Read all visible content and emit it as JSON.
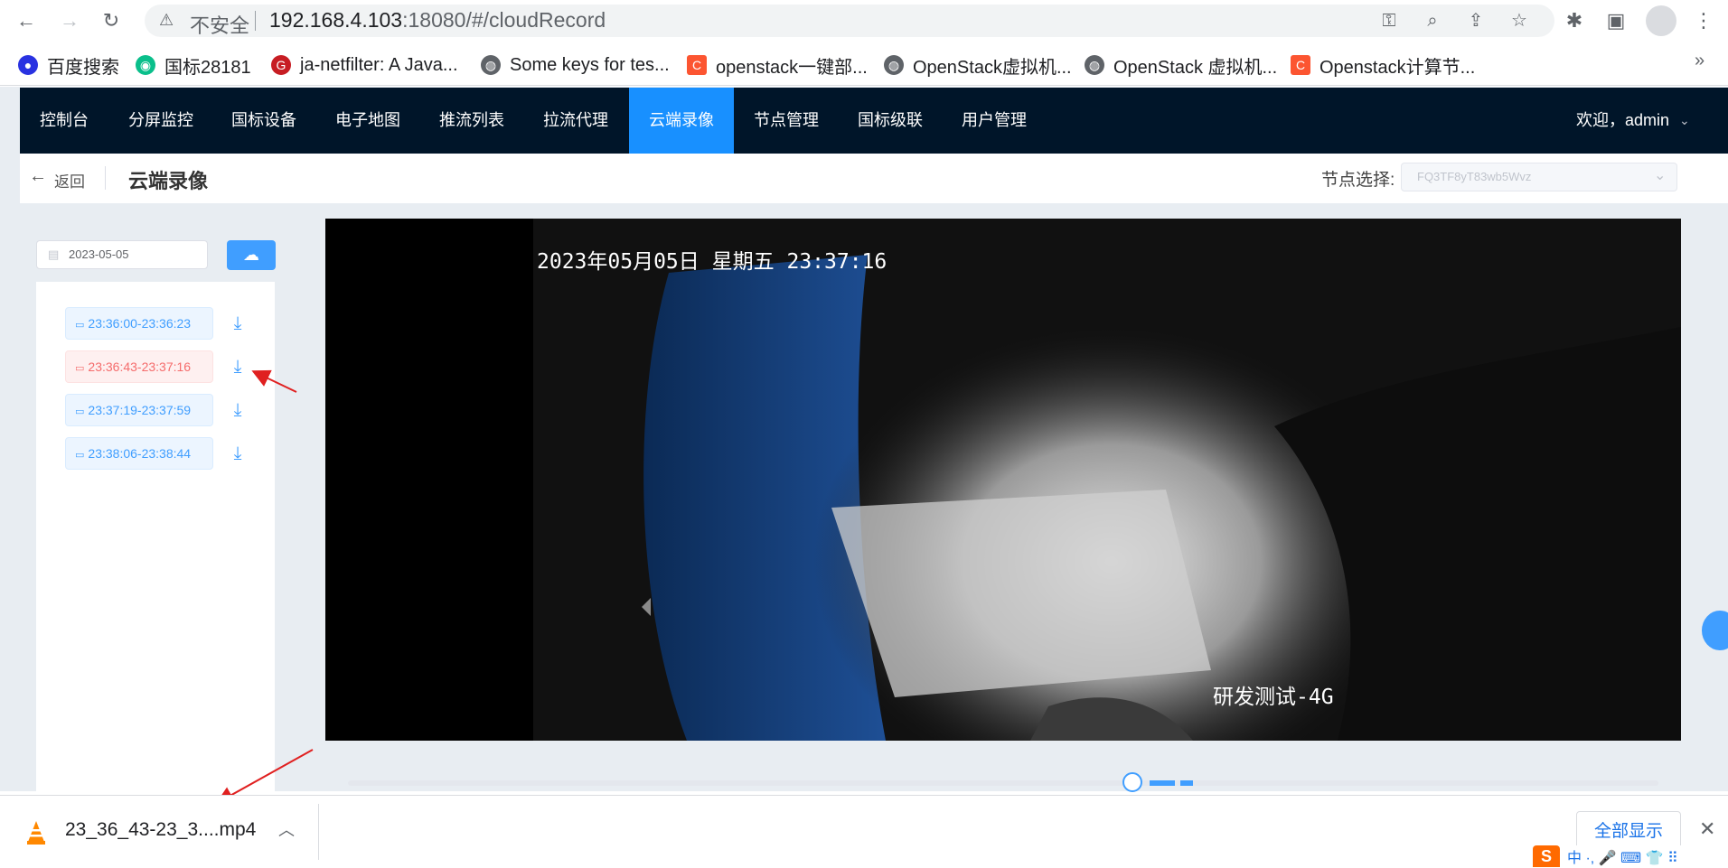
{
  "browser": {
    "url_insecure_label": "不安全",
    "url_host": "192.168.4.103",
    "url_rest": ":18080/#/cloudRecord",
    "bookmarks": [
      {
        "label": "百度搜索",
        "icon": "baidu-icon",
        "color": "#2932e1"
      },
      {
        "label": "国标28181",
        "icon": "gb-icon",
        "color": "#0abf8b"
      },
      {
        "label": "ja-netfilter: A Java...",
        "icon": "gitee-icon",
        "color": "#c71d23"
      },
      {
        "label": "Some keys for tes...",
        "icon": "globe-icon",
        "color": "#5f6368"
      },
      {
        "label": "openstack一键部...",
        "icon": "csdn-icon",
        "color": "#fc5531"
      },
      {
        "label": "OpenStack虚拟机...",
        "icon": "globe-icon",
        "color": "#5f6368"
      },
      {
        "label": "OpenStack 虚拟机...",
        "icon": "globe-icon",
        "color": "#5f6368"
      },
      {
        "label": "Openstack计算节...",
        "icon": "csdn-icon",
        "color": "#fc5531"
      }
    ]
  },
  "nav": {
    "items": [
      "控制台",
      "分屏监控",
      "国标设备",
      "电子地图",
      "推流列表",
      "拉流代理",
      "云端录像",
      "节点管理",
      "国标级联",
      "用户管理"
    ],
    "active_index": 6,
    "welcome": "欢迎，admin"
  },
  "header": {
    "back_label": "返回",
    "title": "云端录像",
    "node_label": "节点选择:",
    "node_value": "FQ3TF8yT83wb5Wvz"
  },
  "sidebar": {
    "date": "2023-05-05",
    "records": [
      {
        "range": "23:36:00-23:36:23",
        "selected": false
      },
      {
        "range": "23:36:43-23:37:16",
        "selected": true
      },
      {
        "range": "23:37:19-23:37:59",
        "selected": false
      },
      {
        "range": "23:38:06-23:38:44",
        "selected": false
      }
    ]
  },
  "video": {
    "timestamp": "2023年05月05日  星期五  23:37:16",
    "camera_label": "研发测试-4G"
  },
  "download": {
    "filename": "23_36_43-23_3....mp4",
    "show_all": "全部显示"
  },
  "ime": {
    "text": "中 ·, 🎤 ⌨ 👕 ⠿"
  }
}
